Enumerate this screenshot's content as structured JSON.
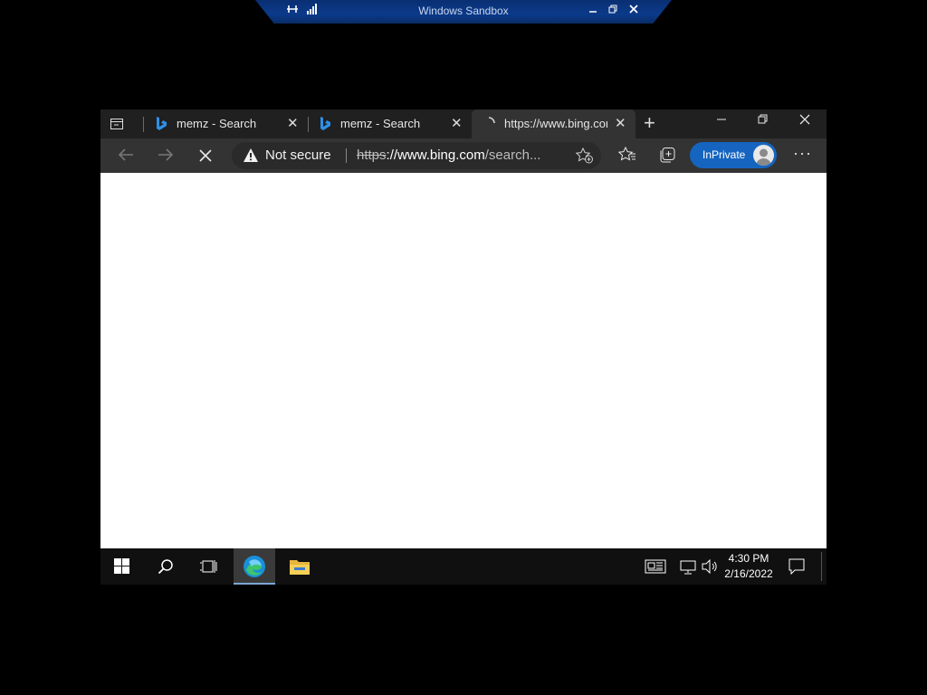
{
  "sandbox": {
    "title": "Windows Sandbox"
  },
  "tabs": [
    {
      "label": "memz - Search",
      "active": false
    },
    {
      "label": "memz - Search",
      "active": false
    },
    {
      "label": "https://www.bing.com",
      "active": true
    }
  ],
  "address": {
    "security_label": "Not secure",
    "url_protocol": "https",
    "url_host": "://www.bing.com",
    "url_path": "/search..."
  },
  "profile": {
    "label": "InPrivate"
  },
  "clock": {
    "time": "4:30 PM",
    "date": "2/16/2022"
  },
  "colors": {
    "accent": "#1565c0",
    "taskbar": "#101010",
    "tabstrip": "#202020",
    "toolbar": "#333333"
  },
  "icons": [
    "pin-icon",
    "signal-icon",
    "minimize-icon",
    "restore-icon",
    "close-icon",
    "tab-actions-icon",
    "bing-icon",
    "loading-icon",
    "new-tab-icon",
    "back-icon",
    "forward-icon",
    "stop-icon",
    "warning-icon",
    "add-favorite-icon",
    "favorites-icon",
    "collections-icon",
    "more-icon",
    "windows-start-icon",
    "search-icon",
    "task-view-icon",
    "edge-icon",
    "file-explorer-icon",
    "news-icon",
    "network-icon",
    "volume-icon",
    "notification-icon"
  ]
}
